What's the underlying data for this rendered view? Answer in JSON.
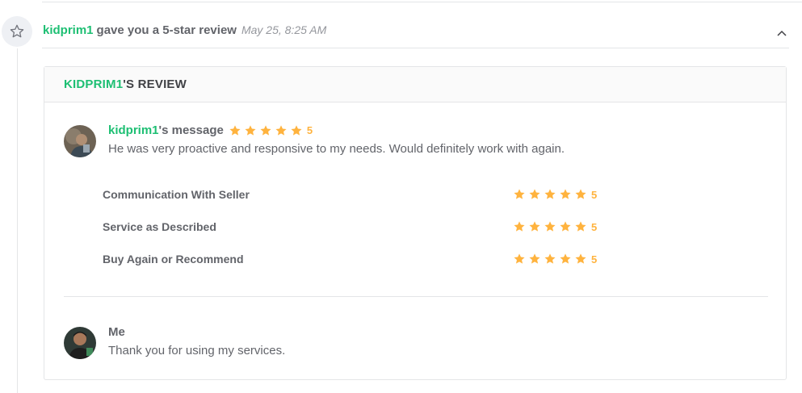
{
  "event": {
    "user": "kidprim1",
    "action": "gave you a 5-star review",
    "time": "May 25, 8:25 AM",
    "icon": "star-outline-icon"
  },
  "review": {
    "header_user": "KIDPRIM1",
    "header_rest": "'S REVIEW",
    "buyer": {
      "name": "kidprim1",
      "title_suffix": "'s message",
      "rating": "5",
      "message": "He was very proactive and responsive to my needs. Would definitely work with again."
    },
    "ratings": [
      {
        "label": "Communication With Seller",
        "value": "5"
      },
      {
        "label": "Service as Described",
        "value": "5"
      },
      {
        "label": "Buy Again or Recommend",
        "value": "5"
      }
    ],
    "reply": {
      "name": "Me",
      "message": "Thank you for using my services."
    }
  },
  "colors": {
    "accent": "#1dbf73",
    "star": "#ffb33e",
    "text": "#62646a",
    "border": "#e4e5e7"
  }
}
